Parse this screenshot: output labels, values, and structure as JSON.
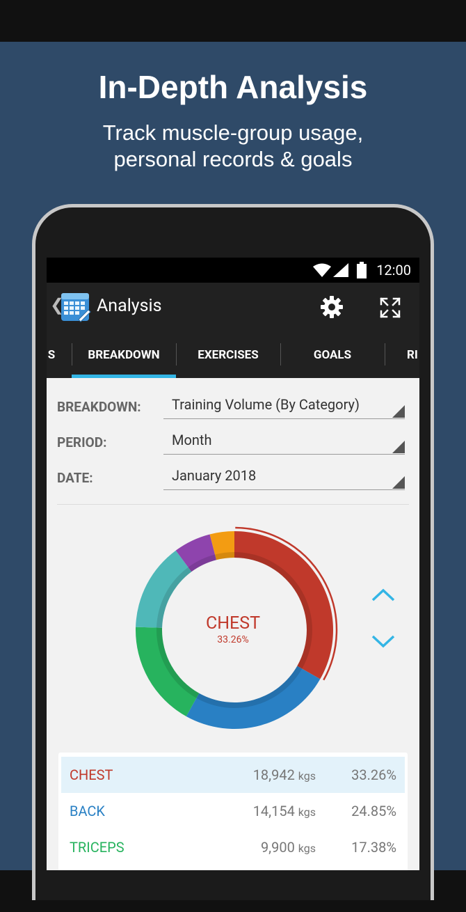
{
  "promo": {
    "headline": "In-Depth Analysis",
    "subline_1": "Track muscle-group usage,",
    "subline_2": "personal records & goals"
  },
  "status_bar": {
    "time": "12:00",
    "icons": [
      "wifi-icon",
      "signal-icon",
      "battery-icon"
    ]
  },
  "app_bar": {
    "title": "Analysis",
    "actions": [
      "gear-icon",
      "fullscreen-icon"
    ]
  },
  "tabs": [
    {
      "label": "S"
    },
    {
      "label": "BREAKDOWN",
      "selected": true
    },
    {
      "label": "EXERCISES"
    },
    {
      "label": "GOALS"
    },
    {
      "label": "RI"
    }
  ],
  "form": {
    "breakdown_label": "BREAKDOWN:",
    "breakdown_value": "Training Volume (By Category)",
    "period_label": "PERIOD:",
    "period_value": "Month",
    "date_label": "DATE:",
    "date_value": "January 2018"
  },
  "donut": {
    "selected_name": "CHEST",
    "selected_pct": "33.26%"
  },
  "chart_data": {
    "type": "pie",
    "categories": [
      "CHEST",
      "BACK",
      "TRICEPS",
      "",
      "",
      ""
    ],
    "values": [
      33.26,
      24.85,
      17.38,
      14.4,
      6.1,
      4.01
    ],
    "colors": [
      "#c0392b",
      "#2980c4",
      "#27b35e",
      "#4fb8b8",
      "#8e44ad",
      "#f39c12"
    ]
  },
  "table": {
    "unit": "kgs",
    "rows": [
      {
        "name": "CHEST",
        "value": "18,942",
        "pct": "33.26%",
        "color": "#c0392b",
        "highlight": true
      },
      {
        "name": "BACK",
        "value": "14,154",
        "pct": "24.85%",
        "color": "#2980c4"
      },
      {
        "name": "TRICEPS",
        "value": "9,900",
        "pct": "17.38%",
        "color": "#27b35e"
      }
    ]
  }
}
